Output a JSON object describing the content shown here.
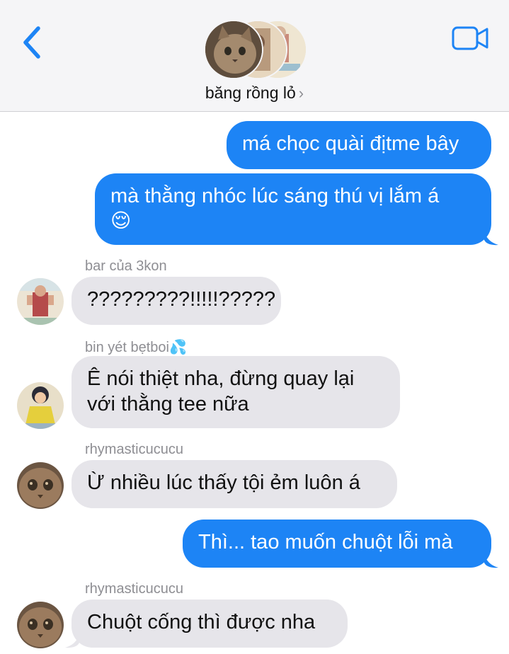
{
  "header": {
    "group_name": "băng rồng lỏ",
    "chevron": "›",
    "back_icon": "chevron-left-icon",
    "video_icon": "video-camera-icon",
    "accent": "#1d84f5"
  },
  "messages": [
    {
      "direction": "outgoing",
      "text": "má chọc quài địtme bây"
    },
    {
      "direction": "outgoing",
      "text": "mà thằng nhóc lúc sáng thú vị lắm á",
      "emoji": "😌"
    },
    {
      "direction": "incoming",
      "sender": "bar của 3kon",
      "text": "?????????!!!!!?????"
    },
    {
      "direction": "incoming",
      "sender": "bin yét bẹtboi💦",
      "text_line1": "Ê nói thiệt nha, đừng quay lại",
      "text_line2": "với thằng tee nữa"
    },
    {
      "direction": "incoming",
      "sender": "rhymasticucucu",
      "text": "Ừ nhiều lúc thấy tội ẻm luôn á"
    },
    {
      "direction": "outgoing",
      "text": "Thì... tao muốn chuột lỗi mà"
    },
    {
      "direction": "incoming",
      "sender": "rhymasticucucu",
      "text": "Chuột cống thì được nha"
    }
  ],
  "colors": {
    "outgoing_bubble": "#1d84f5",
    "incoming_bubble": "#e6e5ea",
    "header_bg": "#f5f5f7"
  }
}
